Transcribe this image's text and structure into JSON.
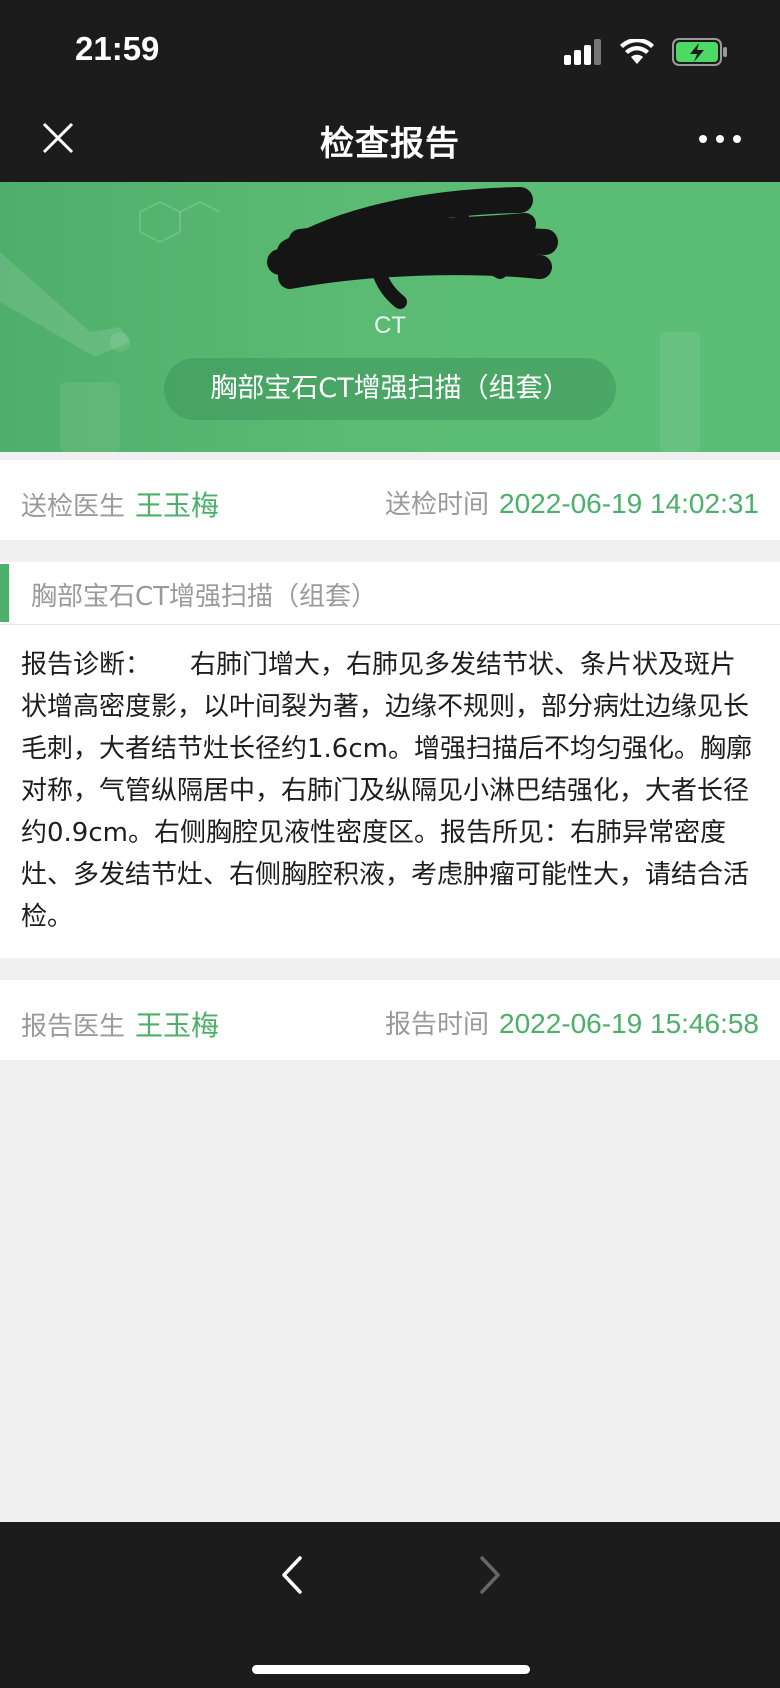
{
  "status_bar": {
    "time": "21:59"
  },
  "nav": {
    "title": "检查报告"
  },
  "banner": {
    "type_label": "CT",
    "exam_name": "胸部宝石CT增强扫描（组套）"
  },
  "submission": {
    "doctor_label": "送检医生",
    "doctor_name": "王玉梅",
    "time_label": "送检时间",
    "time_value": "2022-06-19 14:02:31"
  },
  "report": {
    "exam_title": "胸部宝石CT增强扫描（组套）",
    "body": "报告诊断：　　右肺门增大，右肺见多发结节状、条片状及斑片状增高密度影，以叶间裂为著，边缘不规则，部分病灶边缘见长毛刺，大者结节灶长径约1.6cm。增强扫描后不均匀强化。胸廓对称，气管纵隔居中，右肺门及纵隔见小淋巴结强化，大者长径约0.9cm。右侧胸腔见液性密度区。报告所见：右肺异常密度灶、多发结节灶、右侧胸腔积液，考虑肿瘤可能性大，请结合活检。"
  },
  "reporter": {
    "doctor_label": "报告医生",
    "doctor_name": "王玉梅",
    "time_label": "报告时间",
    "time_value": "2022-06-19 15:46:58"
  },
  "icons": {
    "close": "close-icon",
    "more": "more-icon",
    "back": "chevron-left-icon",
    "forward": "chevron-right-icon",
    "signal": "signal-icon",
    "wifi": "wifi-icon",
    "battery": "battery-charging-icon"
  },
  "colors": {
    "accent_green": "#4caf6a",
    "bar_dark": "#1c1c1c",
    "background": "#f0f0f0"
  }
}
